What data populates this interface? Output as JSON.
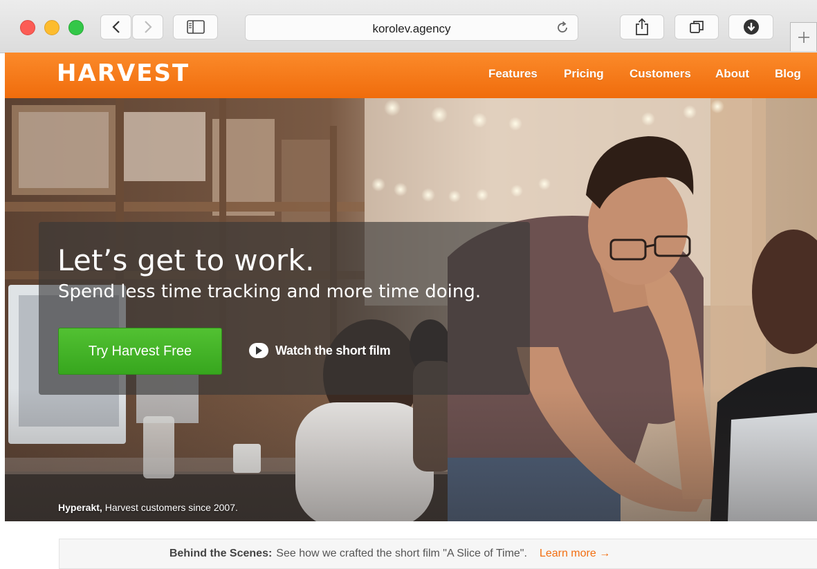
{
  "browser": {
    "url": "korolev.agency",
    "icons": {
      "back": "chevron-left-icon",
      "forward": "chevron-right-icon",
      "sidebar": "sidebar-icon",
      "reload": "reload-icon",
      "share": "share-icon",
      "tabs": "tabs-icon",
      "download": "download-icon",
      "new_tab": "plus-icon"
    }
  },
  "site": {
    "logo": "HARVEST",
    "brand_color": "#f07612",
    "nav": [
      "Features",
      "Pricing",
      "Customers",
      "About",
      "Blog"
    ]
  },
  "hero": {
    "headline": "Let’s get to work.",
    "subheadline": "Spend less time tracking and more time doing.",
    "cta_label": "Try Harvest Free",
    "cta_color": "#45b42a",
    "film_label": "Watch the short film",
    "caption_company": "Hyperakt,",
    "caption_text": " Harvest customers since 2007."
  },
  "banner": {
    "lead": "Behind the Scenes:",
    "text": "See how we crafted the short film \"A Slice of Time\".",
    "link": "Learn more →"
  }
}
